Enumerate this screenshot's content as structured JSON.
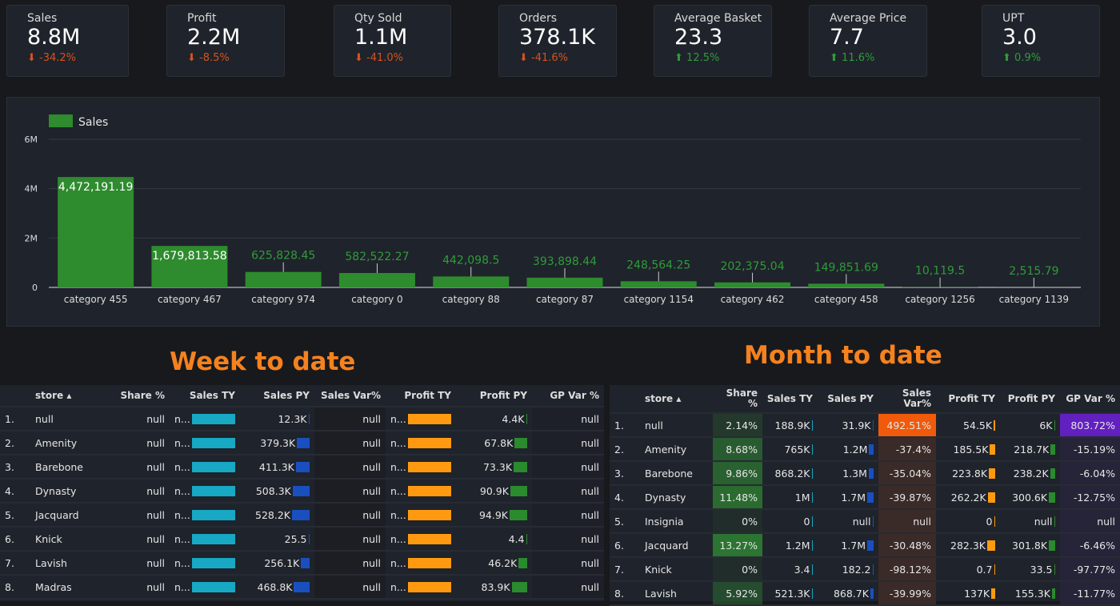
{
  "kpis": [
    {
      "label": "Sales",
      "value": "8.8M",
      "change": "-34.2%",
      "dir": "down"
    },
    {
      "label": "Profit",
      "value": "2.2M",
      "change": "-8.5%",
      "dir": "down"
    },
    {
      "label": "Qty Sold",
      "value": "1.1M",
      "change": "-41.0%",
      "dir": "down"
    },
    {
      "label": "Orders",
      "value": "378.1K",
      "change": "-41.6%",
      "dir": "down"
    },
    {
      "label": "Average Basket",
      "value": "23.3",
      "change": "12.5%",
      "dir": "up"
    },
    {
      "label": "Average Price",
      "value": "7.7",
      "change": "11.6%",
      "dir": "up"
    },
    {
      "label": "UPT",
      "value": "3.0",
      "change": "0.9%",
      "dir": "up"
    }
  ],
  "chart_data": {
    "type": "bar",
    "legend": "Sales",
    "legend_position": "top-left",
    "bar_color": "#2e8b2e",
    "categories": [
      "category 455",
      "category 467",
      "category 974",
      "category 0",
      "category 88",
      "category 87",
      "category 1154",
      "category 462",
      "category 458",
      "category 1256",
      "category 1139"
    ],
    "values": [
      4472191.19,
      1679813.58,
      625828.45,
      582522.27,
      442098.5,
      393898.44,
      248564.25,
      202375.04,
      149851.69,
      10119.5,
      2515.79
    ],
    "labels": [
      "4,472,191.19",
      "1,679,813.58",
      "625,828.45",
      "582,522.27",
      "442,098.5",
      "393,898.44",
      "248,564.25",
      "202,375.04",
      "149,851.69",
      "10,119.5",
      "2,515.79"
    ],
    "y_ticks": [
      "0",
      "2M",
      "4M",
      "6M"
    ],
    "ylim": [
      0,
      6000000
    ],
    "grid": true
  },
  "week": {
    "title": "Week to date",
    "headers": [
      "",
      "store ▴",
      "Share %",
      "Sales TY",
      "Sales PY",
      "Sales Var%",
      "Profit TY",
      "Profit PY",
      "GP Var %"
    ],
    "rows": [
      [
        "1.",
        "null",
        "null",
        "n...",
        "12.3K",
        "null",
        "n...",
        "4.4K",
        "null"
      ],
      [
        "2.",
        "Amenity",
        "null",
        "n...",
        "379.3K",
        "null",
        "n...",
        "67.8K",
        "null"
      ],
      [
        "3.",
        "Barebone",
        "null",
        "n...",
        "411.3K",
        "null",
        "n...",
        "73.3K",
        "null"
      ],
      [
        "4.",
        "Dynasty",
        "null",
        "n...",
        "508.3K",
        "null",
        "n...",
        "90.9K",
        "null"
      ],
      [
        "5.",
        "Jacquard",
        "null",
        "n...",
        "528.2K",
        "null",
        "n...",
        "94.9K",
        "null"
      ],
      [
        "6.",
        "Knick",
        "null",
        "n...",
        "25.5",
        "null",
        "n...",
        "4.4",
        "null"
      ],
      [
        "7.",
        "Lavish",
        "null",
        "n...",
        "256.1K",
        "null",
        "n...",
        "46.2K",
        "null"
      ],
      [
        "8.",
        "Madras",
        "null",
        "n...",
        "468.8K",
        "null",
        "n...",
        "83.9K",
        "null"
      ]
    ]
  },
  "month": {
    "title": "Month to date",
    "headers": [
      "",
      "store ▴",
      "Share %",
      "Sales TY",
      "Sales PY",
      "Sales Var%",
      "Profit TY",
      "Profit PY",
      "GP Var %"
    ],
    "rows": [
      [
        "1.",
        "null",
        "2.14%",
        "188.9K",
        "31.9K",
        "492.51%",
        "54.5K",
        "6K",
        "803.72%"
      ],
      [
        "2.",
        "Amenity",
        "8.68%",
        "765K",
        "1.2M",
        "-37.4%",
        "185.5K",
        "218.7K",
        "-15.19%"
      ],
      [
        "3.",
        "Barebone",
        "9.86%",
        "868.2K",
        "1.3M",
        "-35.04%",
        "223.8K",
        "238.2K",
        "-6.04%"
      ],
      [
        "4.",
        "Dynasty",
        "11.48%",
        "1M",
        "1.7M",
        "-39.87%",
        "262.2K",
        "300.6K",
        "-12.75%"
      ],
      [
        "5.",
        "Insignia",
        "0%",
        "0",
        "null",
        "null",
        "0",
        "null",
        "null"
      ],
      [
        "6.",
        "Jacquard",
        "13.27%",
        "1.2M",
        "1.7M",
        "-30.48%",
        "282.3K",
        "301.8K",
        "-6.46%"
      ],
      [
        "7.",
        "Knick",
        "0%",
        "3.4",
        "182.2",
        "-98.12%",
        "0.7",
        "33.5",
        "-97.77%"
      ],
      [
        "8.",
        "Lavish",
        "5.92%",
        "521.3K",
        "868.7K",
        "-39.99%",
        "137K",
        "155.3K",
        "-11.77%"
      ]
    ]
  },
  "colors": {
    "sales_ty": "#17a8c4",
    "sales_py": "#1a4fc0",
    "profit_ty": "#ff9a10",
    "profit_py": "#2a8a2e",
    "heading": "#f5821f",
    "var_high": "#f05a0a",
    "gp_high": "#6320c0"
  }
}
